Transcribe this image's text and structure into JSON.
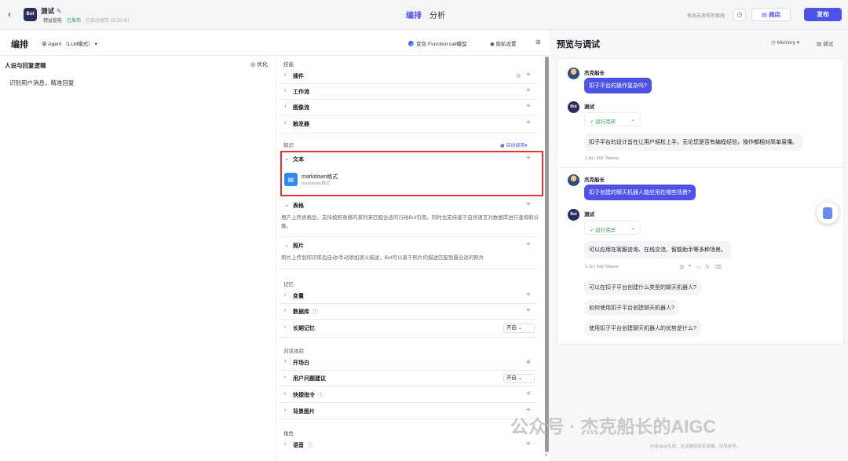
{
  "topbar": {
    "back_icon": "chevron-left",
    "bot_avatar": "Bot",
    "bot_name": "测试",
    "team": "精益智能",
    "status": "已发布",
    "autosave": "已自动保存 15:50:40",
    "tabs": [
      {
        "label": "编排",
        "active": true
      },
      {
        "label": "分析",
        "active": false
      }
    ],
    "unpublished": "有尚未发布的修改",
    "store_label": "商店",
    "publish_label": "发布",
    "accent_color": "#4d53e8"
  },
  "left": {
    "title": "编排",
    "agent_mode": "单 Agent （LLM模式）",
    "model": "豆包·Function call模型",
    "privacy": "隐私设置",
    "persona_title": "人设与回复逻辑",
    "optimize": "优化",
    "persona_text": "识别用户消息，精准回复"
  },
  "config": {
    "skills_section": "技能",
    "skills": [
      {
        "label": "插件"
      },
      {
        "label": "工作流"
      },
      {
        "label": "图像流"
      },
      {
        "label": "触发器"
      }
    ],
    "knowledge_section": "知识",
    "auto_call": "自动调用",
    "text_label": "文本",
    "file_name": "markdown格式",
    "file_sub": "markdown格式",
    "table_label": "表格",
    "table_desc": "用户上传表格后，支持按照表格的某列来匹配合适的行给Bot引用，同时也支持基于自然语言对数据库进行查询和计算。",
    "photo_label": "照片",
    "photo_desc": "照片上传到知识库后自动/手动添加语义描述，Bot可以基于照片的描述匹配到最合适的照片",
    "memory_section": "记忆",
    "variable_label": "变量",
    "database_label": "数据库",
    "longmem_label": "长期记忆",
    "longmem_value": "开启",
    "dialog_section": "对话体验",
    "opening_label": "开场白",
    "suggest_label": "用户问题建议",
    "suggest_value": "开启",
    "shortcut_label": "快捷指令",
    "bg_label": "背景图片",
    "role_section": "角色",
    "voice_label": "语音"
  },
  "right": {
    "title": "预览与调试",
    "memory": "Memory",
    "debug": "调试",
    "conv1": {
      "user_name": "杰克船长",
      "user_msg": "扣子平台的操作复杂吗?",
      "bot_name": "测试",
      "run_status": "运行完毕",
      "bot_msg": "扣子平台的设计旨在让用户轻松上手，无论您是否有编程经验，操作都相对简单易懂。",
      "tokens": "1.8s | 506 Tokens"
    },
    "conv2": {
      "user_name": "杰克船长",
      "user_msg": "扣子创建的聊天机器人能应用在哪些场景?",
      "bot_name": "测试",
      "run_status": "运行完毕",
      "bot_msg": "可以应用在客服咨询、在线交流、智能助手等多种场景。",
      "tokens": "1.2s | 542 Tokens",
      "suggestions": [
        "可以在扣子平台创建什么类型的聊天机器人?",
        "如何使用扣子平台创建聊天机器人?",
        "使用扣子平台创建聊天机器人的优势是什么?"
      ]
    },
    "footer": "内容由AI生成，无法确保真实准确，仅供参考。"
  },
  "watermark": "公众号 · 杰克船长的AIGC"
}
